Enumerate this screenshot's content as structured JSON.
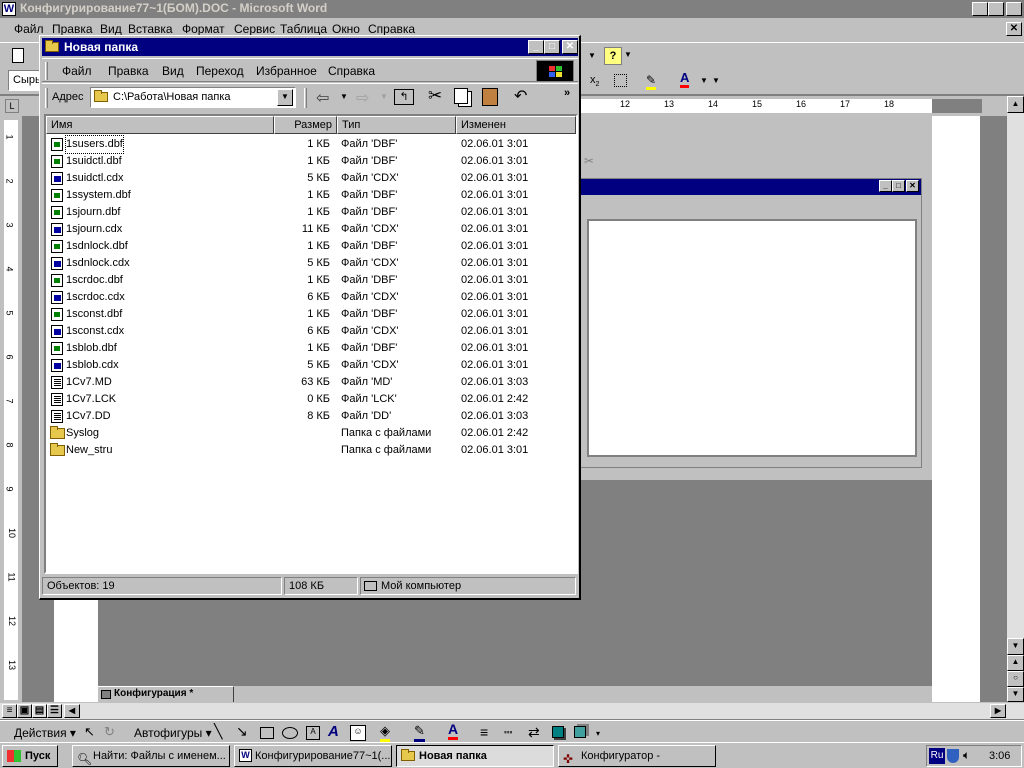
{
  "word": {
    "title": "Конфигурирование77~1(БОМ).DOC - Microsoft Word",
    "menu": [
      "Файл",
      "Правка",
      "Вид",
      "Вставка",
      "Формат",
      "Сервис",
      "Таблица",
      "Окно",
      "Справка"
    ],
    "style_box": "Сыры",
    "ruler_numbers": [
      "12",
      "13",
      "14",
      "15",
      "16",
      "17",
      "18"
    ],
    "vruler_numbers": [
      "1",
      "2",
      "3",
      "4",
      "5",
      "6",
      "7",
      "8",
      "9",
      "10",
      "11",
      "12",
      "13",
      "14"
    ],
    "drawing": {
      "actions": "Действия",
      "autoshapes": "Автофигуры"
    }
  },
  "inner_doc_tab": "Конфигурация *",
  "explorer": {
    "title": "Новая папка",
    "menu": [
      "Файл",
      "Правка",
      "Вид",
      "Переход",
      "Избранное",
      "Справка"
    ],
    "address_label": "Адрес",
    "address_value": "C:\\Работа\\Новая папка",
    "columns": [
      "Имя",
      "Размер",
      "Тип",
      "Изменен"
    ],
    "files": [
      {
        "name": "1susers.dbf",
        "size": "1 КБ",
        "type": "Файл 'DBF'",
        "date": "02.06.01 3:01",
        "icon": "dbf"
      },
      {
        "name": "1suidctl.dbf",
        "size": "1 КБ",
        "type": "Файл 'DBF'",
        "date": "02.06.01 3:01",
        "icon": "dbf"
      },
      {
        "name": "1suidctl.cdx",
        "size": "5 КБ",
        "type": "Файл 'CDX'",
        "date": "02.06.01 3:01",
        "icon": "cdx"
      },
      {
        "name": "1ssystem.dbf",
        "size": "1 КБ",
        "type": "Файл 'DBF'",
        "date": "02.06.01 3:01",
        "icon": "dbf"
      },
      {
        "name": "1sjourn.dbf",
        "size": "1 КБ",
        "type": "Файл 'DBF'",
        "date": "02.06.01 3:01",
        "icon": "dbf"
      },
      {
        "name": "1sjourn.cdx",
        "size": "11 КБ",
        "type": "Файл 'CDX'",
        "date": "02.06.01 3:01",
        "icon": "cdx"
      },
      {
        "name": "1sdnlock.dbf",
        "size": "1 КБ",
        "type": "Файл 'DBF'",
        "date": "02.06.01 3:01",
        "icon": "dbf"
      },
      {
        "name": "1sdnlock.cdx",
        "size": "5 КБ",
        "type": "Файл 'CDX'",
        "date": "02.06.01 3:01",
        "icon": "cdx"
      },
      {
        "name": "1scrdoc.dbf",
        "size": "1 КБ",
        "type": "Файл 'DBF'",
        "date": "02.06.01 3:01",
        "icon": "dbf"
      },
      {
        "name": "1scrdoc.cdx",
        "size": "6 КБ",
        "type": "Файл 'CDX'",
        "date": "02.06.01 3:01",
        "icon": "cdx"
      },
      {
        "name": "1sconst.dbf",
        "size": "1 КБ",
        "type": "Файл 'DBF'",
        "date": "02.06.01 3:01",
        "icon": "dbf"
      },
      {
        "name": "1sconst.cdx",
        "size": "6 КБ",
        "type": "Файл 'CDX'",
        "date": "02.06.01 3:01",
        "icon": "cdx"
      },
      {
        "name": "1sblob.dbf",
        "size": "1 КБ",
        "type": "Файл 'DBF'",
        "date": "02.06.01 3:01",
        "icon": "dbf"
      },
      {
        "name": "1sblob.cdx",
        "size": "5 КБ",
        "type": "Файл 'CDX'",
        "date": "02.06.01 3:01",
        "icon": "cdx"
      },
      {
        "name": "1Cv7.MD",
        "size": "63 КБ",
        "type": "Файл 'MD'",
        "date": "02.06.01 3:03",
        "icon": "doc"
      },
      {
        "name": "1Cv7.LCK",
        "size": "0 КБ",
        "type": "Файл 'LCK'",
        "date": "02.06.01 2:42",
        "icon": "doc"
      },
      {
        "name": "1Cv7.DD",
        "size": "8 КБ",
        "type": "Файл 'DD'",
        "date": "02.06.01 3:03",
        "icon": "doc"
      },
      {
        "name": "Syslog",
        "size": "",
        "type": "Папка с файлами",
        "date": "02.06.01 2:42",
        "icon": "folder"
      },
      {
        "name": "New_stru",
        "size": "",
        "type": "Папка с файлами",
        "date": "02.06.01 3:01",
        "icon": "folder"
      }
    ],
    "status": {
      "objects": "Объектов: 19",
      "size": "108 КБ",
      "location": "Мой компьютер"
    }
  },
  "taskbar": {
    "start": "Пуск",
    "tasks": [
      "Найти: Файлы с именем...",
      "Конфигурирование77~1(...",
      "Новая папка",
      "Конфигуратор -"
    ],
    "lang": "Ru",
    "clock": "3:06"
  },
  "colors": {
    "titlebar": "#000080",
    "desktop": "#808080",
    "face": "#c0c0c0"
  }
}
